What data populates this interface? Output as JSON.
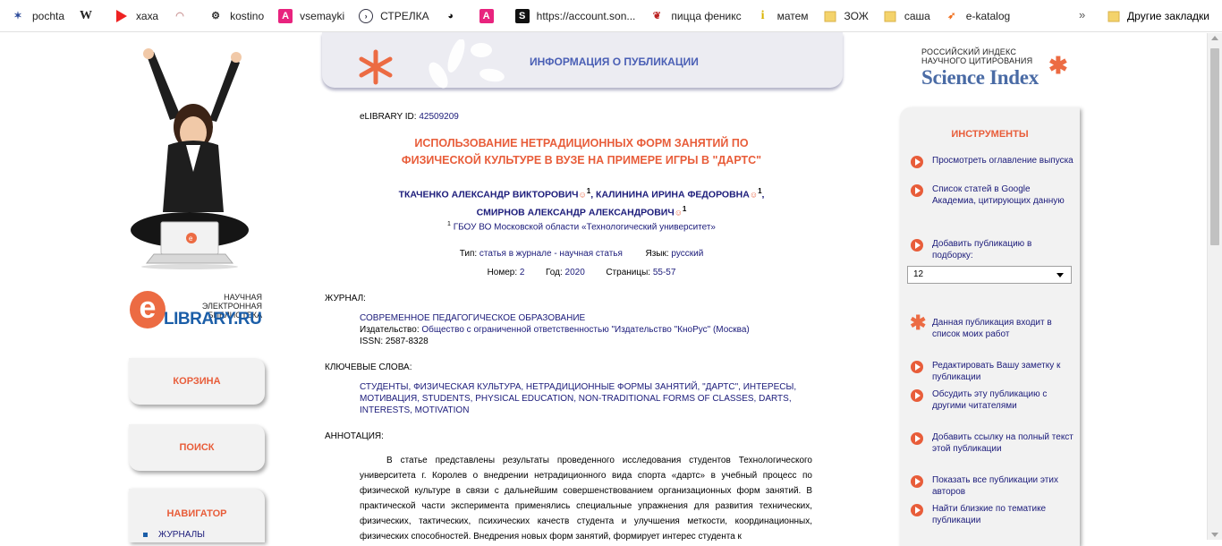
{
  "bookmarks": {
    "items": [
      {
        "label": "pochta",
        "icon": "emblem-icon"
      },
      {
        "label": "",
        "icon": "wikipedia-icon"
      },
      {
        "label": "хаха",
        "icon": "youtube-play-icon"
      },
      {
        "label": "",
        "icon": "pizza-icon"
      },
      {
        "label": "kostino",
        "icon": "gears-icon"
      },
      {
        "label": "vsemayki",
        "icon": "letter-a-icon"
      },
      {
        "label": "СТРЕЛКА",
        "icon": "arrow-circle-icon"
      },
      {
        "label": "",
        "icon": "mask-icon"
      },
      {
        "label": "",
        "icon": "letter-a-icon"
      },
      {
        "label": "https://account.son...",
        "icon": "s-logo-icon"
      },
      {
        "label": "пицца феникс",
        "icon": "phoenix-icon"
      },
      {
        "label": "матем",
        "icon": "info-icon"
      },
      {
        "label": "ЗОЖ",
        "icon": "folder-icon"
      },
      {
        "label": "саша",
        "icon": "folder-icon"
      },
      {
        "label": "e-katalog",
        "icon": "rocket-icon"
      }
    ],
    "more": "»",
    "other": "Другие закладки"
  },
  "left": {
    "logo_small": "НАУЧНАЯ ЭЛЕКТРОННАЯ БИБЛИОТЕКА",
    "logo_big": "LIBRARY.RU",
    "logo_letter": "e",
    "cart": "КОРЗИНА",
    "search": "ПОИСК",
    "navigator": "НАВИГАТОР",
    "nav_item": "ЖУРНАЛЫ"
  },
  "header": {
    "title": "ИНФОРМАЦИЯ О ПУБЛИКАЦИИ"
  },
  "publication": {
    "id_label": "eLIBRARY ID:",
    "id_value": "42509209",
    "title_line1": "ИСПОЛЬЗОВАНИЕ НЕТРАДИЦИОННЫХ ФОРМ ЗАНЯТИЙ ПО",
    "title_line2": "ФИЗИЧЕСКОЙ КУЛЬТУРЕ В ВУЗЕ НА ПРИМЕРЕ ИГРЫ В \"ДАРТС\"",
    "author1": "ТКАЧЕНКО АЛЕКСАНДР ВИКТОРОВИЧ",
    "author2": "КАЛИНИНА ИРИНА ФЕДОРОВНА",
    "author3": "СМИРНОВ АЛЕКСАНДР АЛЕКСАНДРОВИЧ",
    "aff_num": "1",
    "affiliation": "ГБОУ ВО Московской области «Технологический университет»",
    "type_label": "Тип:",
    "type_value": "статья в журнале - научная статья",
    "lang_label": "Язык:",
    "lang_value": "русский",
    "number_label": "Номер:",
    "number_value": "2",
    "year_label": "Год:",
    "year_value": "2020",
    "pages_label": "Страницы:",
    "pages_value": "55-57",
    "journal_label": "ЖУРНАЛ:",
    "journal_name": "СОВРЕМЕННОЕ ПЕДАГОГИЧЕСКОЕ ОБРАЗОВАНИЕ",
    "publisher_label": "Издательство:",
    "publisher_value": "Общество с ограниченной ответственностью \"Издательство \"КноРус\" (Москва)",
    "issn": "ISSN: 2587-8328",
    "keywords_label": "КЛЮЧЕВЫЕ СЛОВА:",
    "keywords": "СТУДЕНТЫ, ФИЗИЧЕСКАЯ КУЛЬТУРА, НЕТРАДИЦИОННЫЕ ФОРМЫ ЗАНЯТИЙ, \"ДАРТС\", ИНТЕРЕСЫ, МОТИВАЦИЯ, STUDENTS, PHYSICAL EDUCATION, NON-TRADITIONAL FORMS OF CLASSES, DARTS, INTERESTS, MOTIVATION",
    "abstract_label": "АННОТАЦИЯ:",
    "abstract": "В статье представлены результаты проведенного исследования студентов Технологического университета г. Королев о внедрении нетрадиционного вида спорта «дартс» в учебный процесс по физической культуре в связи с дальнейшим совершенствованием организационных форм занятий. В практической части эксперимента применялись специальные упражнения для развития технических, физических, тактических, психических качеств студента и улучшения меткости, координационных, физических способностей. Внедрения новых форм занятий, формирует интерес студента к"
  },
  "right": {
    "si_small1": "РОССИЙСКИЙ ИНДЕКС",
    "si_small2": "НАУЧНОГО ЦИТИРОВАНИЯ",
    "si_big": "Science Index",
    "tools_title": "ИНСТРУМЕНТЫ",
    "tool1": "Просмотреть оглавление выпуска",
    "tool2": "Список статей в Google Академиа, цитирующих данную",
    "tool3": "Добавить публикацию в подборку:",
    "select_value": "12",
    "tool4": "Данная публикация входит в список моих работ",
    "tool5": "Редактировать Вашу заметку к публикации",
    "tool6": "Обсудить эту публикацию с другими читателями",
    "tool7": "Добавить ссылку на полный текст этой публикации",
    "tool8": "Показать все публикации этих авторов",
    "tool9": "Найти близкие по тематике публикации"
  },
  "colors": {
    "accent": "#e85d3a",
    "link": "#1b1b7a",
    "header_title": "#4a5fb5"
  }
}
